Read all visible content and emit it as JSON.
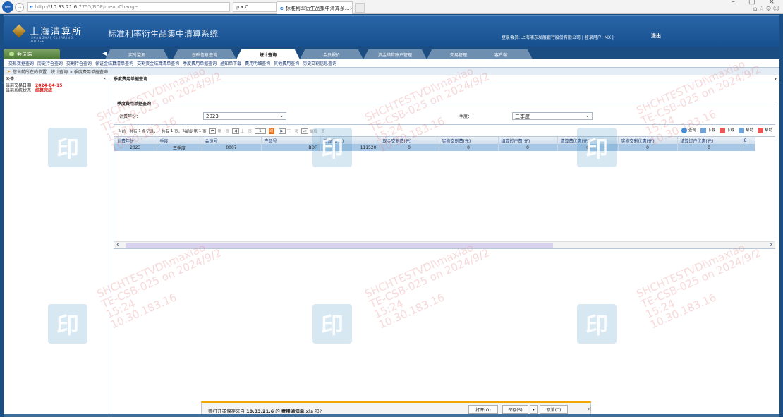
{
  "browser": {
    "url_prefix": "http://",
    "url_host": "10.33.21.6",
    "url_rest": ":7755/BDF/menuChange",
    "search_hint": "ρ ▾ C",
    "tab_title": "标准利率衍生品集中清算系...",
    "tab_close": "×"
  },
  "header": {
    "logo_text": "上海清算所",
    "logo_sub": "SHANGHAI CLEARING HOUSE",
    "system_title": "标准利率衍生品集中清算系统",
    "login_info": "登录会员: 上海浦东发展银行股份有限公司 | 登录用户: MX |",
    "logout": "退出"
  },
  "menu": {
    "member_tab": "会员端",
    "tabs": [
      "实时监测",
      "基础信息查询",
      "统计查询",
      "会员报价",
      "资金结算账户管理",
      "交易管理",
      "客户端"
    ]
  },
  "submenu": {
    "items": [
      "交易数据查询",
      "历史持仓查询",
      "交割持仓查询",
      "保证金结算清单查询",
      "交割资金结算清单查询",
      "季度费用单据查询",
      "通知单下载",
      "费用明细查询",
      "其他费用查询",
      "历史交割信息查询"
    ]
  },
  "location": {
    "label": "您当前所在的位置：",
    "path": "统计查询 > 季度费用单据查询"
  },
  "left": {
    "title": "公告",
    "trade_date_label": "当前交易日期：",
    "trade_date": "2024-04-15",
    "status_label": "当前系统状态：",
    "status": "结算完成"
  },
  "right": {
    "title": "季度费用单据查询",
    "legend": "季度费用单据查询：",
    "year_label": "计费年份：",
    "year_value": "2023",
    "quarter_label": "季度：",
    "quarter_value": "三季度"
  },
  "pager": {
    "text1": "当前一共有",
    "total_records": "1",
    "text2": "条记录，一共有",
    "total_pages": "1",
    "text3": "页，当前是第",
    "current_page": "1",
    "text4": "页",
    "first": "第一页",
    "prev": "上一页",
    "page_input": "1",
    "go": "跳",
    "next": "下一页",
    "last": "最后一页"
  },
  "actions": {
    "query": "查询",
    "download1": "下载",
    "download2": "下载",
    "help1": "帮助",
    "help2": "帮助"
  },
  "table": {
    "headers": [
      "计费年份",
      "季度",
      "会员号",
      "产品号",
      "清算费(元)",
      "现金交割费(元)",
      "实物交割费(元)",
      "结算过户费(元)",
      "清算费优惠(元)",
      "实物交割优惠(元)",
      "结算过户优惠(元)",
      "8"
    ],
    "rows": [
      [
        "2023",
        "三季度",
        "0007",
        "BDF",
        "111520",
        "0",
        "0",
        "0",
        "0",
        "0",
        "0",
        ""
      ]
    ]
  },
  "watermark": {
    "line1": "SHCHTESTVDI\\maxiao",
    "line2": "TE-CSB-025 on 2024/9/2",
    "line3": "15:24",
    "line4": "10.30.183.16",
    "seal": "印"
  },
  "download_bar": {
    "message_prefix": "要打开或保存来自 ",
    "host": "10.33.21.6",
    "message_mid": " 的 ",
    "filename": "费用通知单.xls",
    "message_suffix": " 吗?",
    "open": "打开(O)",
    "save": "保存(S)",
    "save_more": "▾",
    "cancel": "取消(C)",
    "close": "×"
  }
}
